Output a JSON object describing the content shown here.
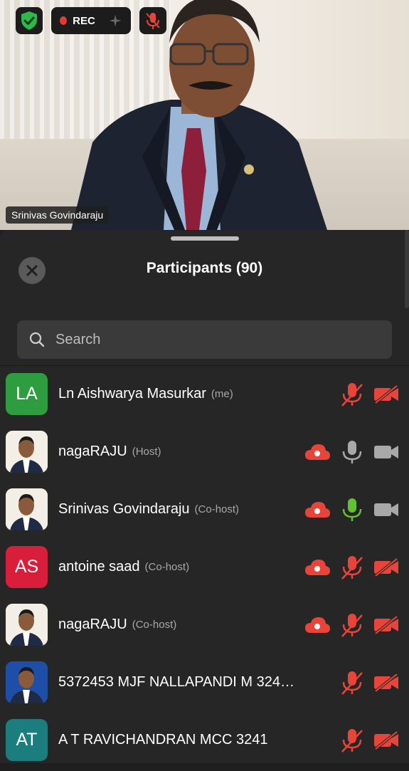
{
  "video": {
    "rec_label": "REC",
    "speaker_name": "Srinivas Govindaraju"
  },
  "panel": {
    "title": "Participants (90)",
    "search_placeholder": "Search"
  },
  "colors": {
    "accent_red": "#e8443a",
    "mic_active_green": "#62c132",
    "icon_grey": "#a8a8a8"
  },
  "participants": [
    {
      "initials": "LA",
      "avatar_color": "#2e9d3f",
      "name": "Ln Aishwarya Masurkar",
      "role": "(me)",
      "cloud": false,
      "mic": "muted",
      "video": "off"
    },
    {
      "initials": "",
      "avatar_color": "#ffffff",
      "name": "nagaRAJU",
      "role": "(Host)",
      "cloud": true,
      "mic": "on",
      "video": "on"
    },
    {
      "initials": "",
      "avatar_color": "#ffffff",
      "name": "Srinivas Govindaraju",
      "role": "(Co-host)",
      "cloud": true,
      "mic": "speaking",
      "video": "on"
    },
    {
      "initials": "AS",
      "avatar_color": "#d81e3a",
      "name": "antoine saad",
      "role": "(Co-host)",
      "cloud": true,
      "mic": "muted",
      "video": "off"
    },
    {
      "initials": "",
      "avatar_color": "#ffffff",
      "name": "nagaRAJU",
      "role": "(Co-host)",
      "cloud": true,
      "mic": "muted",
      "video": "off"
    },
    {
      "initials": "",
      "avatar_color": "#1e4fa8",
      "name": "5372453 MJF NALLAPANDI M 324…",
      "role": "",
      "cloud": false,
      "mic": "muted",
      "video": "off"
    },
    {
      "initials": "AT",
      "avatar_color": "#1b7d7d",
      "name": "A T RAVICHANDRAN MCC 3241",
      "role": "",
      "cloud": false,
      "mic": "muted",
      "video": "off"
    }
  ]
}
